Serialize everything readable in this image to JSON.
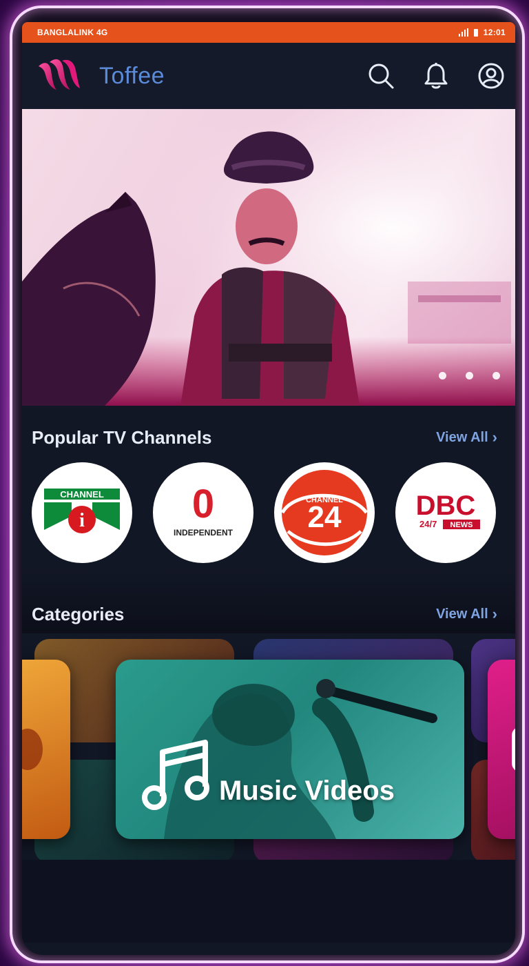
{
  "status_bar": {
    "carrier": "BANGLALINK 4G",
    "time": "12:01"
  },
  "app_bar": {
    "title": "Toffee"
  },
  "hero": {
    "dots": 3
  },
  "popular_channels": {
    "title": "Popular TV Channels",
    "view_all": "View All",
    "channels": [
      {
        "name": "CHANNEL i",
        "logo_text": "CHANNEL",
        "logo_text2": "i"
      },
      {
        "name": "INDEPENDENT",
        "logo_text": "0",
        "logo_text2": "INDEPENDENT"
      },
      {
        "name": "CHANNEL 24",
        "logo_text": "CHANNEL",
        "logo_text2": "24"
      },
      {
        "name": "DBC 24/7 NEWS",
        "logo_text": "DBC",
        "logo_text2": "24/7",
        "logo_text3": "NEWS"
      }
    ]
  },
  "categories": {
    "title": "Categories",
    "view_all": "View All",
    "featured": {
      "label": "Music Videos"
    }
  },
  "colors": {
    "status_bar": "#e6521c",
    "app_background": "#121726",
    "accent_title": "#5b8bd8",
    "view_all": "#7fa4e2",
    "brand_pink": "#e0197a"
  }
}
